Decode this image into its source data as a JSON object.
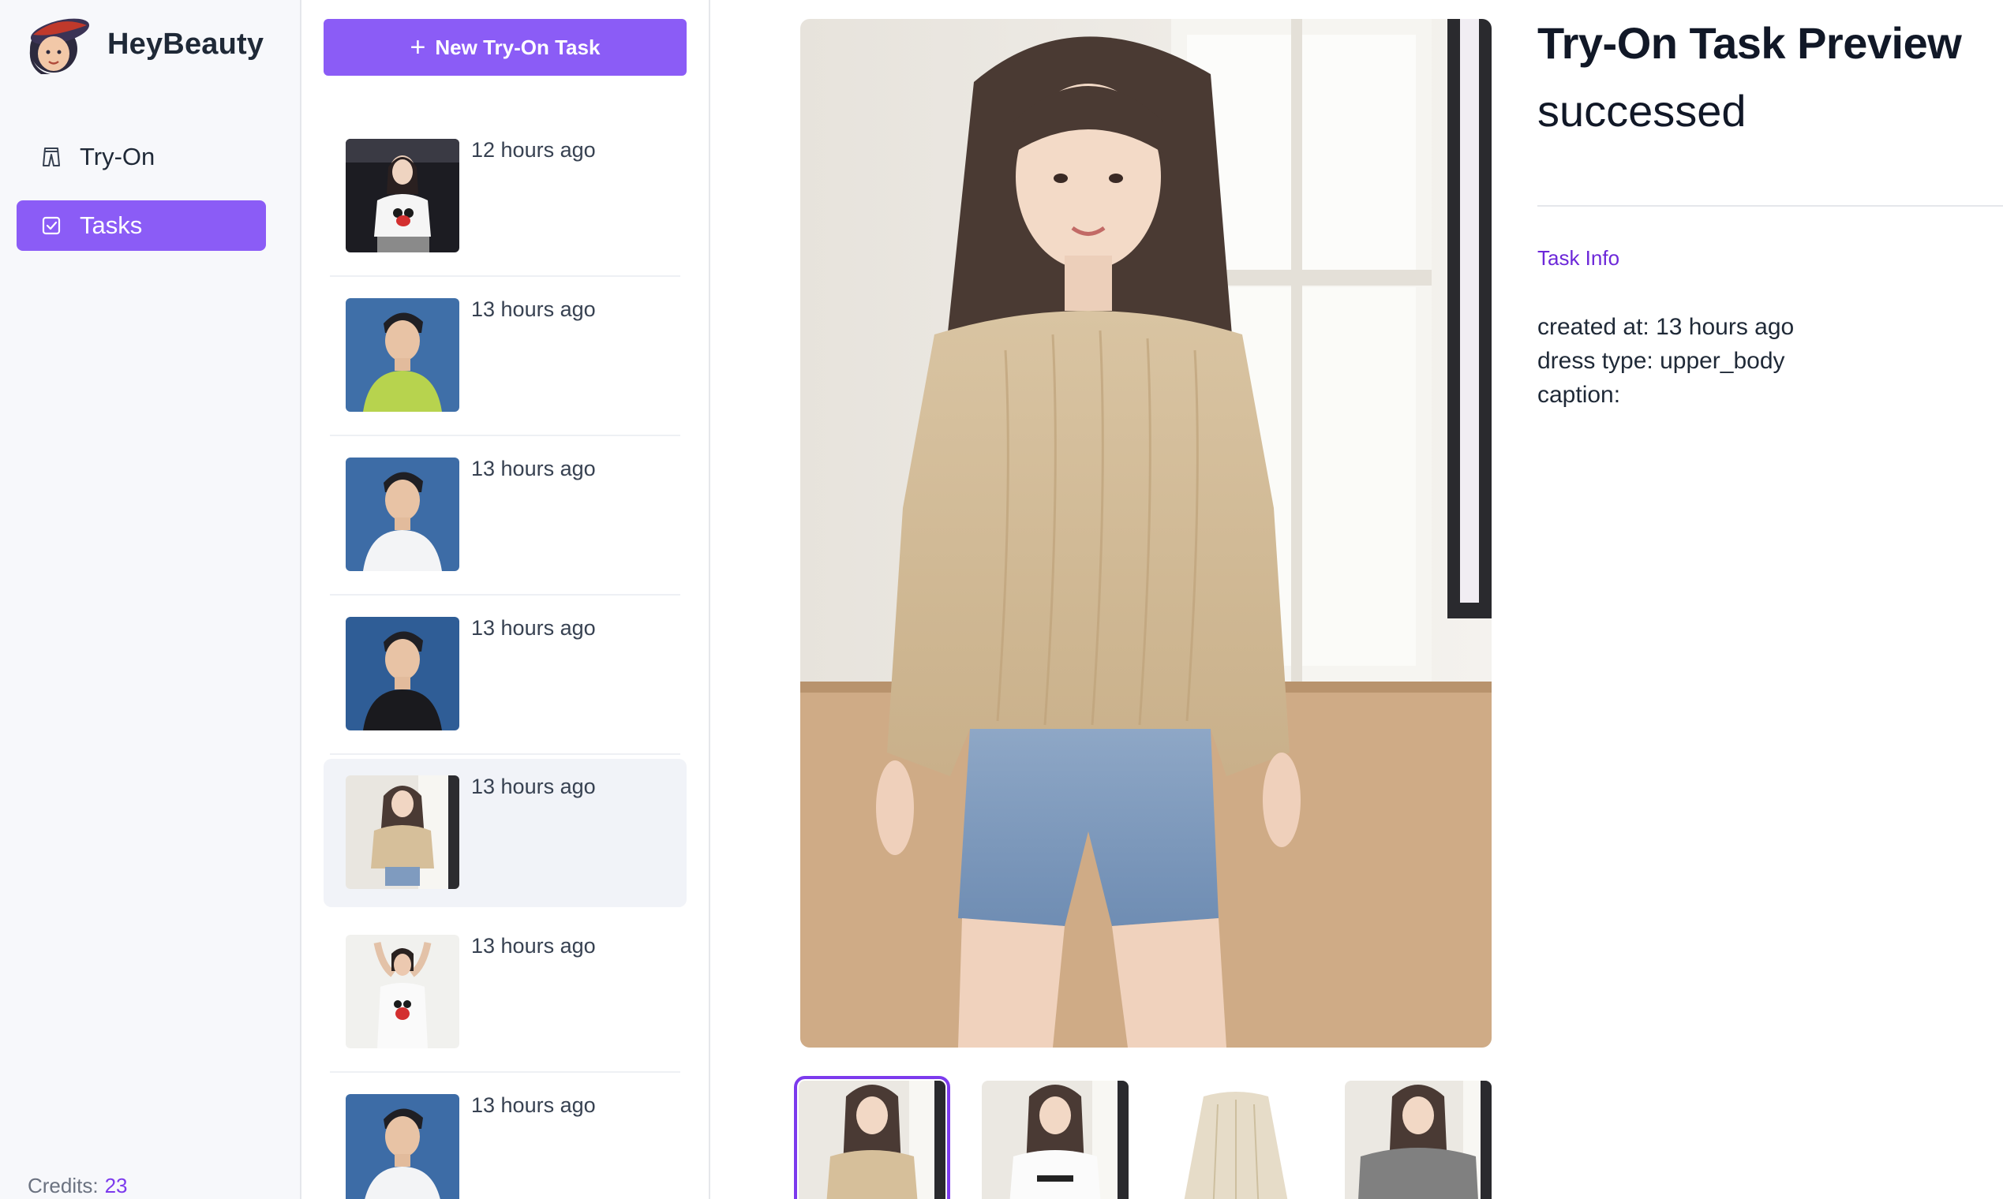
{
  "app": {
    "name": "HeyBeauty"
  },
  "sidebar": {
    "items": [
      {
        "label": "Try-On",
        "icon": "pants-icon",
        "active": false
      },
      {
        "label": "Tasks",
        "icon": "checkbox-icon",
        "active": true
      }
    ],
    "credits_label": "Credits:",
    "credits_value": "23"
  },
  "tasklist": {
    "new_task_label": "New Try-On Task",
    "tasks": [
      {
        "time": "12 hours ago",
        "thumb": "woman-minnie-tshirt",
        "active": false
      },
      {
        "time": "13 hours ago",
        "thumb": "man-green-polo",
        "active": false
      },
      {
        "time": "13 hours ago",
        "thumb": "man-white-tshirt",
        "active": false
      },
      {
        "time": "13 hours ago",
        "thumb": "man-black-tshirt",
        "active": false
      },
      {
        "time": "13 hours ago",
        "thumb": "woman-knit-sweater",
        "active": true
      },
      {
        "time": "13 hours ago",
        "thumb": "woman-minnie-tank",
        "active": false
      },
      {
        "time": "13 hours ago",
        "thumb": "man-white-tshirt",
        "active": false
      }
    ]
  },
  "preview": {
    "thumbnails": [
      "result",
      "model",
      "garment",
      "mask"
    ],
    "selected": 0
  },
  "info": {
    "title": "Try-On Task Preview",
    "status": "successed",
    "section_label": "Task Info",
    "created_at": "created at: 13 hours ago",
    "dress_type": "dress type: upper_body",
    "caption": "caption:"
  },
  "colors": {
    "accent": "#8b5cf6",
    "accent_text": "#7c3aed",
    "sidebar_bg": "#f7f8fb",
    "active_row_bg": "#f1f3f8"
  }
}
